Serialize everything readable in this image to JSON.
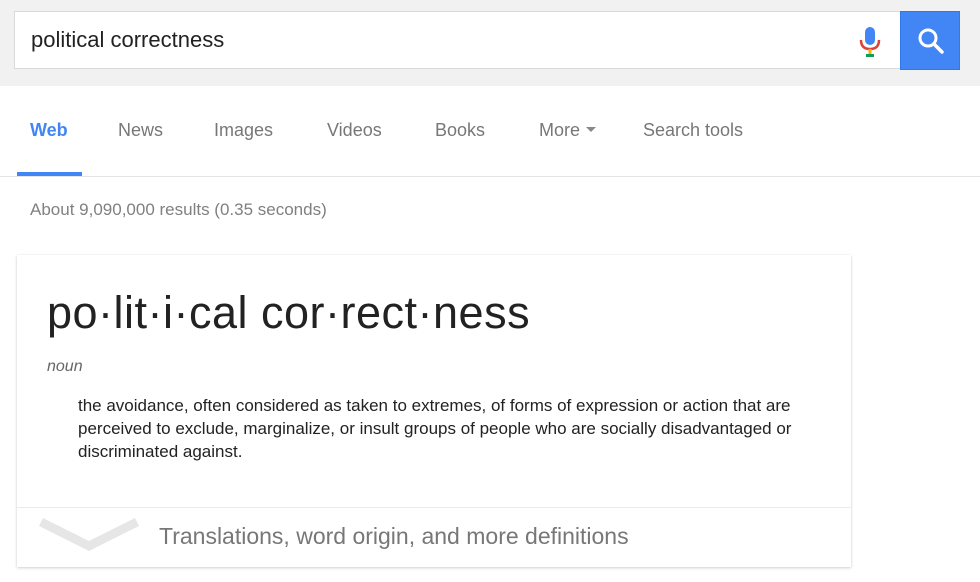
{
  "search": {
    "query": "political correctness"
  },
  "tabs": [
    {
      "label": "Web",
      "active": true
    },
    {
      "label": "News",
      "active": false
    },
    {
      "label": "Images",
      "active": false
    },
    {
      "label": "Videos",
      "active": false
    },
    {
      "label": "Books",
      "active": false
    },
    {
      "label": "More",
      "active": false
    },
    {
      "label": "Search tools",
      "active": false
    }
  ],
  "result_stats": "About 9,090,000 results (0.35 seconds)",
  "definition_card": {
    "headword": "po·lit·i·cal cor·rect·ness",
    "part_of_speech": "noun",
    "definition": "the avoidance, often considered as taken to extremes, of forms of expression or action that are perceived to exclude, marginalize, or insult groups of people who are socially disadvantaged or discriminated against.",
    "expander_label": "Translations, word origin, and more definitions"
  },
  "colors": {
    "accent": "#4285f4",
    "header_bg": "#f1f1f1",
    "muted_text": "#777777"
  },
  "icons": {
    "mic": "microphone-icon",
    "search": "search-icon",
    "expand": "chevron-down-icon"
  }
}
